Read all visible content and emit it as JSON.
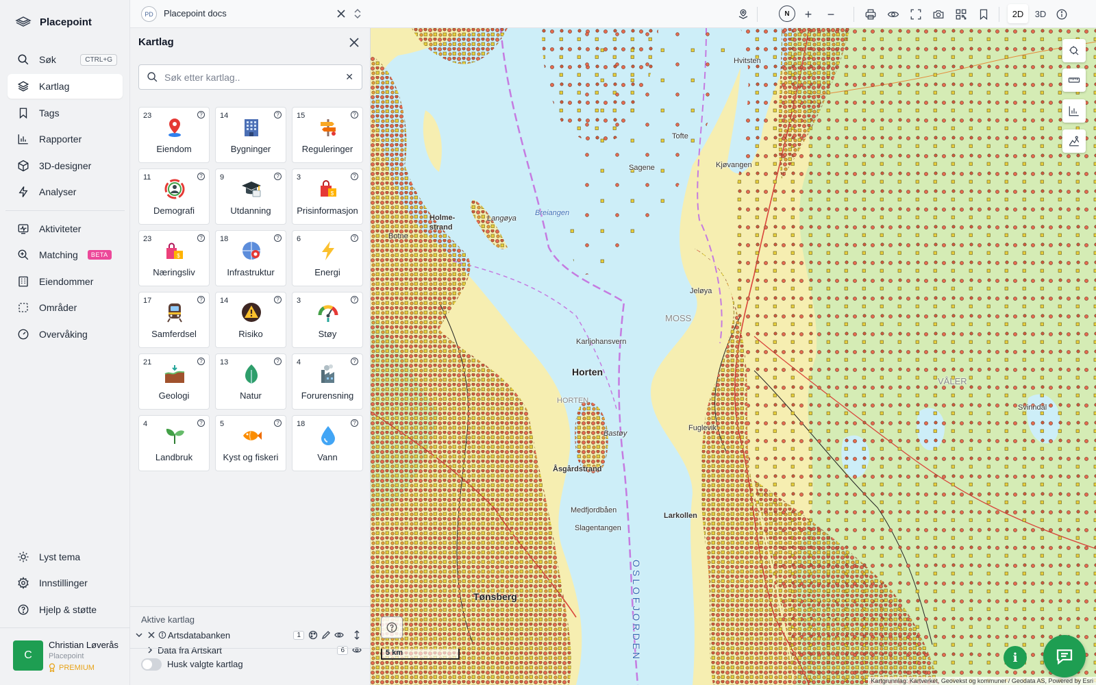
{
  "app": {
    "name": "Placepoint"
  },
  "nav": {
    "items": [
      {
        "label": "Søk",
        "icon": "search-icon",
        "shortcut": "CTRL+G"
      },
      {
        "label": "Kartlag",
        "icon": "layers-icon",
        "active": true
      },
      {
        "label": "Tags",
        "icon": "bookmark-icon"
      },
      {
        "label": "Rapporter",
        "icon": "bar-chart-icon"
      },
      {
        "label": "3D-designer",
        "icon": "cube-icon"
      },
      {
        "label": "Analyser",
        "icon": "bolt-icon"
      },
      {
        "label": "Aktiviteter",
        "icon": "activity-icon"
      },
      {
        "label": "Matching",
        "icon": "magnify-icon",
        "badge": "BETA"
      },
      {
        "label": "Eiendommer",
        "icon": "building-icon"
      },
      {
        "label": "Områder",
        "icon": "area-icon"
      },
      {
        "label": "Overvåking",
        "icon": "gauge-icon"
      }
    ],
    "bottom": [
      {
        "label": "Lyst tema",
        "icon": "sun-icon"
      },
      {
        "label": "Innstillinger",
        "icon": "gear-icon"
      },
      {
        "label": "Hjelp & støtte",
        "icon": "help-icon"
      }
    ]
  },
  "user": {
    "initial": "C",
    "name": "Christian Løverås",
    "org": "Placepoint",
    "tier": "PREMIUM"
  },
  "workspace": {
    "badge": "PD",
    "title": "Placepoint docs"
  },
  "toolbar": {
    "compass": "N",
    "zoom_in": "+",
    "zoom_out": "−",
    "mode_2d": "2D",
    "mode_3d": "3D"
  },
  "panel": {
    "title": "Kartlag",
    "search_placeholder": "Søk etter kartlag..",
    "categories": [
      {
        "count": "23",
        "label": "Eiendom",
        "icon": "pin-icon"
      },
      {
        "count": "14",
        "label": "Bygninger",
        "icon": "building-icon"
      },
      {
        "count": "15",
        "label": "Reguleringer",
        "icon": "signpost-icon"
      },
      {
        "count": "11",
        "label": "Demografi",
        "icon": "people-circle-icon"
      },
      {
        "count": "9",
        "label": "Utdanning",
        "icon": "graduation-cap-icon"
      },
      {
        "count": "3",
        "label": "Prisinformasjon",
        "icon": "shopping-bag-icon"
      },
      {
        "count": "23",
        "label": "Næringsliv",
        "icon": "shopping-bags-icon"
      },
      {
        "count": "18",
        "label": "Infrastruktur",
        "icon": "network-icon"
      },
      {
        "count": "6",
        "label": "Energi",
        "icon": "lightning-icon"
      },
      {
        "count": "17",
        "label": "Samferdsel",
        "icon": "train-icon"
      },
      {
        "count": "14",
        "label": "Risiko",
        "icon": "warning-icon"
      },
      {
        "count": "3",
        "label": "Støy",
        "icon": "noise-gauge-icon"
      },
      {
        "count": "21",
        "label": "Geologi",
        "icon": "terrain-icon"
      },
      {
        "count": "13",
        "label": "Natur",
        "icon": "leaf-icon"
      },
      {
        "count": "4",
        "label": "Forurensning",
        "icon": "factory-icon"
      },
      {
        "count": "4",
        "label": "Landbruk",
        "icon": "sprout-icon"
      },
      {
        "count": "5",
        "label": "Kyst og fiskeri",
        "icon": "fish-icon"
      },
      {
        "count": "18",
        "label": "Vann",
        "icon": "water-drop-icon"
      }
    ],
    "active_header": "Aktive kartlag",
    "active_layers": [
      {
        "name": "Artsdatabanken",
        "badge": "1"
      },
      {
        "name": "Data fra Artskart",
        "badge": "6"
      }
    ],
    "remember_label": "Husk valgte kartlag"
  },
  "map": {
    "places": [
      {
        "name": "Horten",
        "style": "big"
      },
      {
        "name": "HORTEN",
        "style": "normal"
      },
      {
        "name": "Holme-strand",
        "style": "bold"
      },
      {
        "name": "Breiangen",
        "style": "water"
      },
      {
        "name": "Bastøy",
        "style": "normal"
      },
      {
        "name": "Åsgårdstrand",
        "style": "bold"
      },
      {
        "name": "Medfjordbåen",
        "style": "normal"
      },
      {
        "name": "Slagentangen",
        "style": "normal"
      },
      {
        "name": "Larkollen",
        "style": "bold"
      },
      {
        "name": "Fuglevik",
        "style": "normal"
      },
      {
        "name": "Jeløya",
        "style": "normal"
      },
      {
        "name": "MOSS",
        "style": "normal"
      },
      {
        "name": "Sagene",
        "style": "normal"
      },
      {
        "name": "Kjøvangen",
        "style": "normal"
      },
      {
        "name": "Tofte",
        "style": "normal"
      },
      {
        "name": "VÅLER",
        "style": "normal"
      },
      {
        "name": "Svinndal",
        "style": "normal"
      },
      {
        "name": "Karljohansvern",
        "style": "normal"
      },
      {
        "name": "Langøya",
        "style": "normal"
      },
      {
        "name": "OSLOFJORDEN",
        "style": "water"
      },
      {
        "name": "Hvitsten",
        "style": "normal"
      },
      {
        "name": "Botne",
        "style": "normal"
      },
      {
        "name": "Tønsberg",
        "style": "big"
      }
    ],
    "scale": "5 km",
    "attribution": "Kartgrunnlag: Kartverket, Geovekst og kommuner / Geodata AS, Powered by Esri",
    "colors": {
      "water": "#cdeef8",
      "land": "#f6eeb1",
      "green": "#d2ecb2",
      "dot": "#e56b4f",
      "dot_alt": "#e7cf3b",
      "accent": "#1e9e52"
    }
  }
}
